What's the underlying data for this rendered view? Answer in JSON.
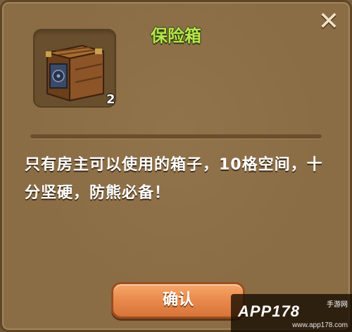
{
  "dialog": {
    "title": "保险箱",
    "close_icon": "close-icon",
    "item": {
      "icon": "safe-box-icon",
      "count": "2"
    },
    "description": "只有房主可以使用的箱子，10格空间，十分坚硬，防熊必备！",
    "confirm_label": "确认"
  },
  "watermark": {
    "brand": "APP178",
    "sub": "手游网",
    "url": "www.app178.com"
  },
  "colors": {
    "title": "#b7e64a",
    "panel": "#8a6c45",
    "button": "#e8894b"
  }
}
